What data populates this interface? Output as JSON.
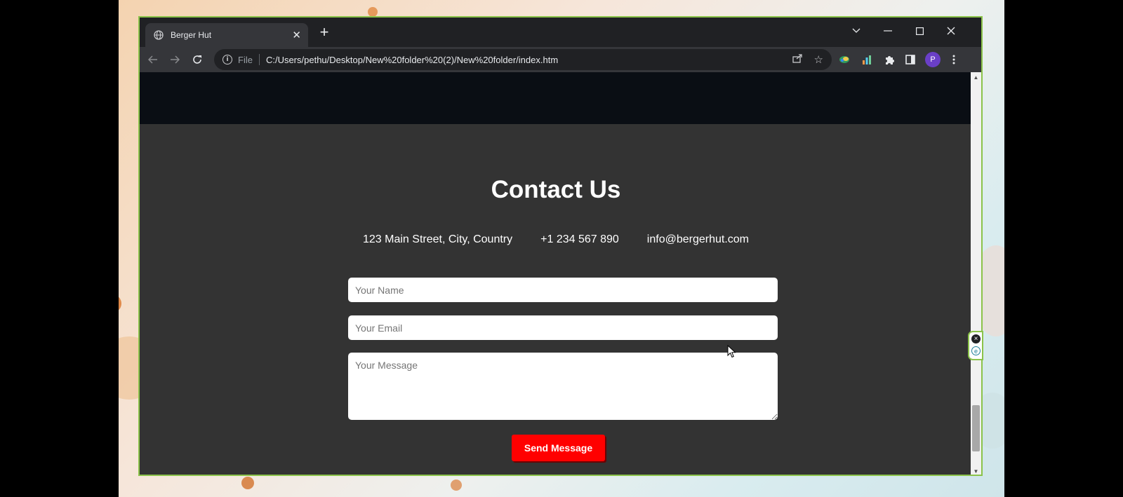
{
  "browser": {
    "tab_title": "Berger Hut",
    "tab_close": "✕",
    "new_tab": "+",
    "url_scheme_label": "File",
    "url": "C:/Users/pethu/Desktop/New%20folder%20(2)/New%20folder/index.htm",
    "profile_initial": "P"
  },
  "page": {
    "contact": {
      "title": "Contact Us",
      "address": "123 Main Street, City, Country",
      "phone": "+1 234 567 890",
      "email": "info@bergerhut.com"
    },
    "form": {
      "name_placeholder": "Your Name",
      "email_placeholder": "Your Email",
      "message_placeholder": "Your Message",
      "submit_label": "Send Message"
    }
  },
  "colors": {
    "page_background": "#333333",
    "header_band": "#0a0e14",
    "submit_button": "#ff0000",
    "window_border": "#8bc34a"
  },
  "icons": [
    "globe-icon",
    "close-icon",
    "plus-icon",
    "chevron-down-icon",
    "minimize-icon",
    "maximize-icon",
    "back-arrow-icon",
    "forward-arrow-icon",
    "reload-icon",
    "info-icon",
    "share-icon",
    "star-icon",
    "puzzle-icon",
    "side-panel-icon",
    "more-vert-icon"
  ]
}
